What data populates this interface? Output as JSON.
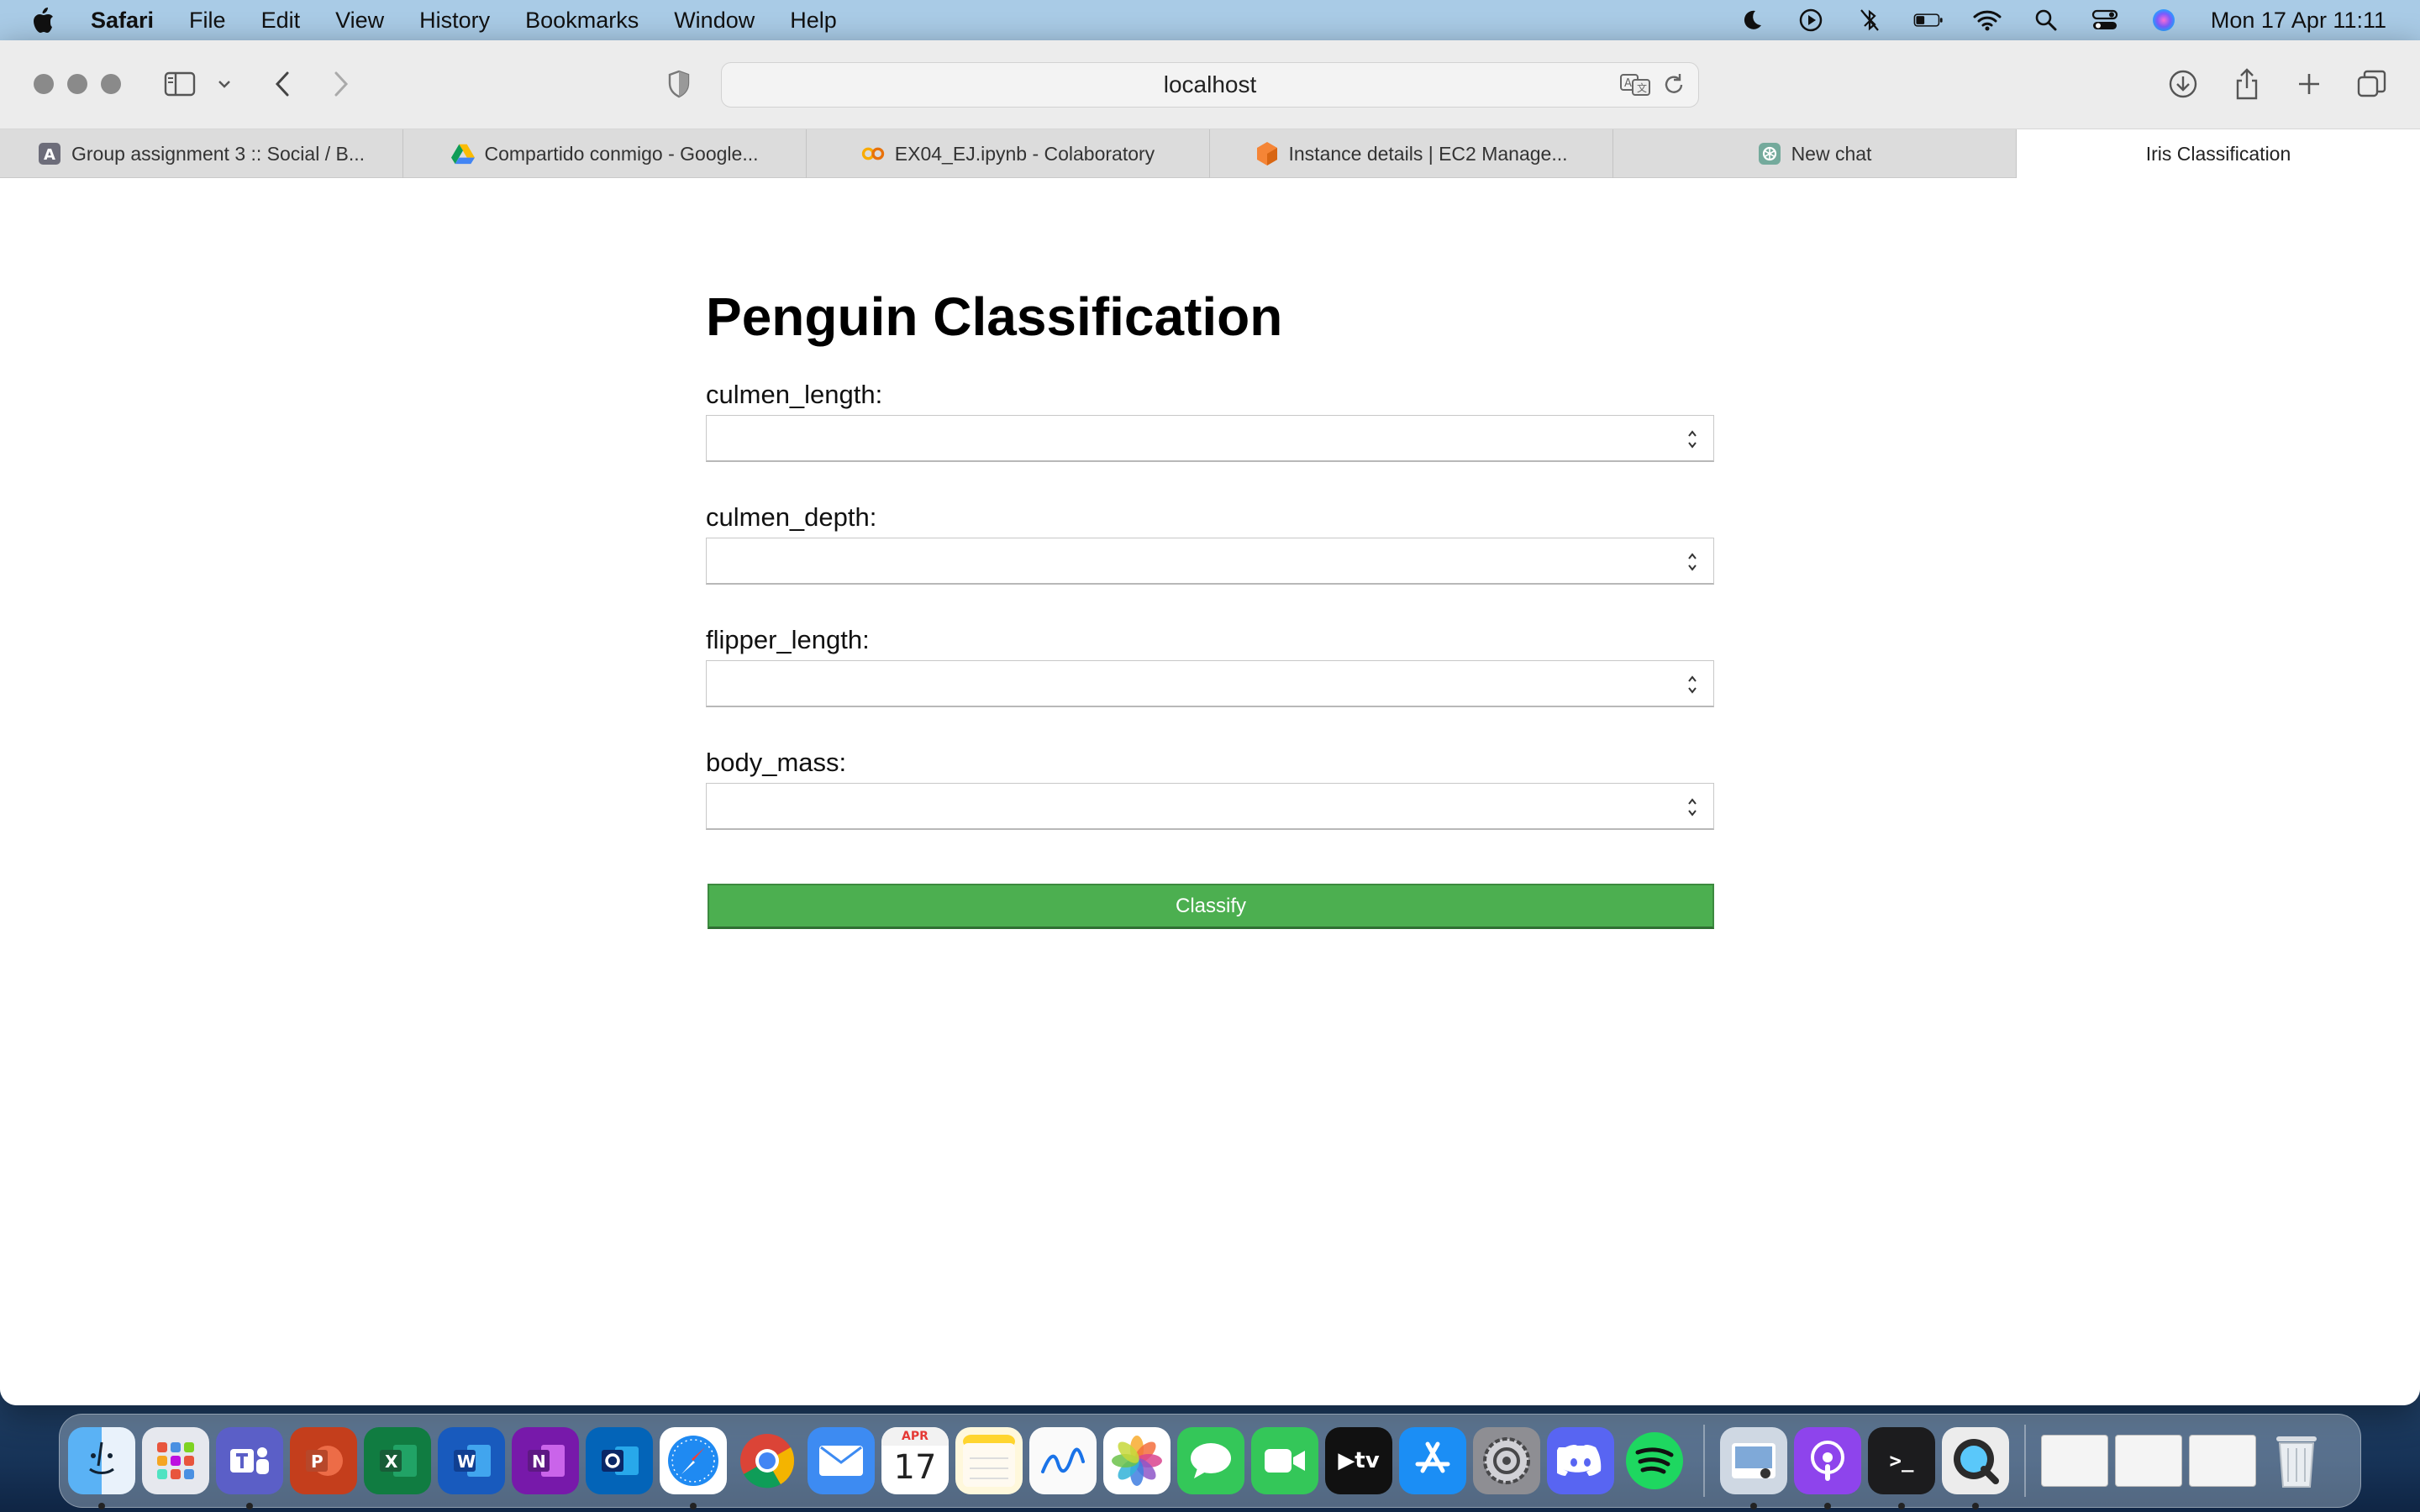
{
  "menubar": {
    "app_name": "Safari",
    "items": [
      "File",
      "Edit",
      "View",
      "History",
      "Bookmarks",
      "Window",
      "Help"
    ],
    "clock": "Mon 17 Apr  11:11"
  },
  "toolbar": {
    "address": "localhost"
  },
  "tabs": [
    {
      "label": "Group assignment 3 :: Social / B...",
      "favicon": "letter-a-icon",
      "favicon_text": "A"
    },
    {
      "label": "Compartido conmigo - Google...",
      "favicon": "google-drive-icon"
    },
    {
      "label": "EX04_EJ.ipynb - Colaboratory",
      "favicon": "colab-icon",
      "favicon_text": "CO"
    },
    {
      "label": "Instance details | EC2 Manage...",
      "favicon": "aws-icon"
    },
    {
      "label": "New chat",
      "favicon": "chatgpt-icon"
    },
    {
      "label": "Iris Classification",
      "active": true
    }
  ],
  "page": {
    "title": "Penguin Classification",
    "fields": [
      {
        "label": "culmen_length:",
        "value": ""
      },
      {
        "label": "culmen_depth:",
        "value": ""
      },
      {
        "label": "flipper_length:",
        "value": ""
      },
      {
        "label": "body_mass:",
        "value": ""
      }
    ],
    "submit_label": "Classify"
  },
  "dock": {
    "calendar_month": "APR",
    "calendar_day": "17"
  },
  "colors": {
    "button_green": "#4caf50",
    "menubar": "#a9cbe6"
  }
}
